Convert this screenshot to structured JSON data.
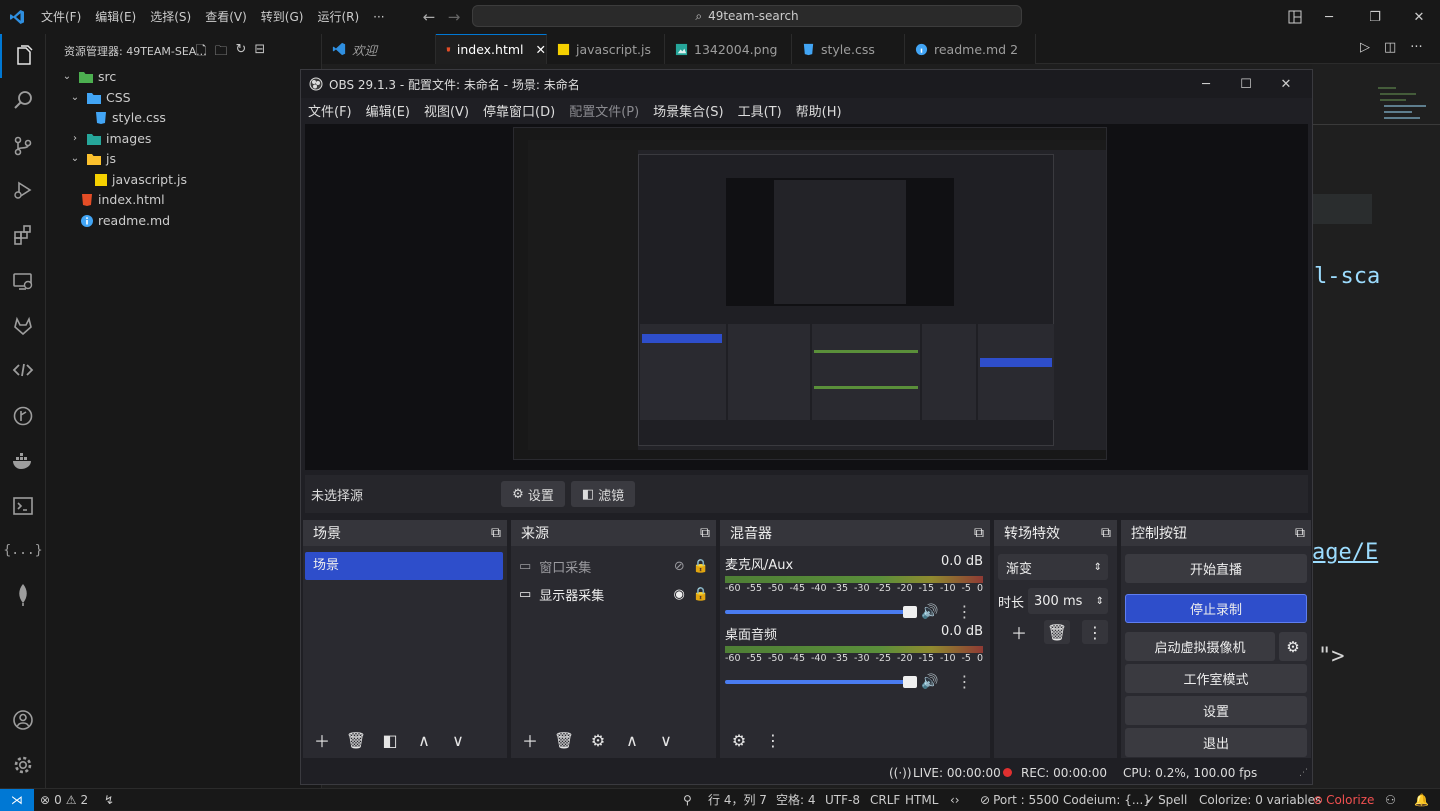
{
  "vscode": {
    "menu": [
      "文件(F)",
      "编辑(E)",
      "选择(S)",
      "查看(V)",
      "转到(G)",
      "运行(R)",
      "···"
    ],
    "search": "49team-search",
    "explorer_title": "资源管理器: 49TEAM-SEA...",
    "tree": [
      {
        "label": "src",
        "type": "folder",
        "open": true
      },
      {
        "label": "CSS",
        "type": "folder",
        "open": true
      },
      {
        "label": "style.css",
        "type": "css"
      },
      {
        "label": "images",
        "type": "folder",
        "open": false
      },
      {
        "label": "js",
        "type": "folder",
        "open": true
      },
      {
        "label": "javascript.js",
        "type": "js"
      },
      {
        "label": "index.html",
        "type": "html"
      },
      {
        "label": "readme.md",
        "type": "info"
      }
    ],
    "tabs": [
      {
        "label": "欢迎",
        "icon": "vscode-icon"
      },
      {
        "label": "index.html",
        "icon": "html-icon",
        "active": true
      },
      {
        "label": "javascript.js",
        "icon": "js-icon"
      },
      {
        "label": "1342004.png",
        "icon": "image-icon"
      },
      {
        "label": "style.css",
        "icon": "css-icon"
      },
      {
        "label": "readme.md 2",
        "icon": "info-icon"
      }
    ],
    "code_fragments": [
      "l-sca",
      "age/E",
      "\">"
    ],
    "status": {
      "errors": "0",
      "warnings": "2",
      "position": "行 4，列 7",
      "spaces": "空格: 4",
      "encoding": "UTF-8",
      "eol": "CRLF",
      "language": "HTML",
      "port": "Port : 5500",
      "codeium": "Codeium: {...}",
      "spell": "Spell",
      "colorize_vars": "Colorize: 0 variables",
      "colorize": "Colorize"
    }
  },
  "obs": {
    "title": "OBS 29.1.3 - 配置文件: 未命名 - 场景: 未命名",
    "menu": [
      {
        "label": "文件(F)"
      },
      {
        "label": "编辑(E)"
      },
      {
        "label": "视图(V)"
      },
      {
        "label": "停靠窗口(D)"
      },
      {
        "label": "配置文件(P)",
        "disabled": true
      },
      {
        "label": "场景集合(S)"
      },
      {
        "label": "工具(T)"
      },
      {
        "label": "帮助(H)"
      }
    ],
    "no_source": "未选择源",
    "settings_btn": "设置",
    "filters_btn": "滤镜",
    "docks": {
      "scenes": {
        "title": "场景",
        "items": [
          "场景"
        ]
      },
      "sources": {
        "title": "来源",
        "items": [
          {
            "label": "窗口采集",
            "visible": false
          },
          {
            "label": "显示器采集",
            "visible": true
          }
        ]
      },
      "mixer": {
        "title": "混音器",
        "ticks": [
          "-60",
          "-55",
          "-50",
          "-45",
          "-40",
          "-35",
          "-30",
          "-25",
          "-20",
          "-15",
          "-10",
          "-5",
          "0"
        ],
        "channels": [
          {
            "name": "麦克风/Aux",
            "db": "0.0 dB",
            "volume": 1.0
          },
          {
            "name": "桌面音频",
            "db": "0.0 dB",
            "volume": 1.0
          }
        ]
      },
      "transitions": {
        "title": "转场特效",
        "transition": "渐变",
        "duration_label": "时长",
        "duration": "300 ms"
      },
      "controls": {
        "title": "控制按钮",
        "buttons": [
          {
            "label": "开始直播"
          },
          {
            "label": "停止录制",
            "active": true
          },
          {
            "label": "启动虚拟摄像机"
          },
          {
            "label": "工作室模式"
          },
          {
            "label": "设置"
          },
          {
            "label": "退出"
          }
        ]
      }
    },
    "status": {
      "live": "LIVE: 00:00:00",
      "rec": "REC: 00:00:00",
      "cpu": "CPU: 0.2%, 100.00 fps"
    }
  },
  "colors": {
    "accent": "#2e4ecb",
    "vscode_bg": "#181818",
    "obs_bg": "#1f1f24",
    "rec_dot": "#e03030"
  }
}
